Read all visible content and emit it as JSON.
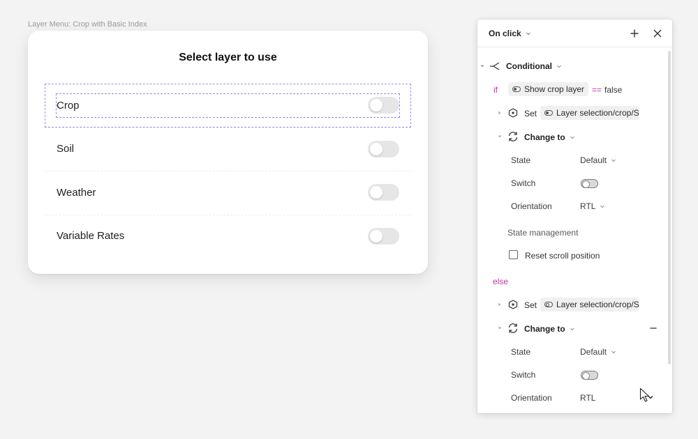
{
  "frame_label": "Layer Menu: Crop with Basic Index",
  "modal": {
    "title": "Select layer to use",
    "layers": [
      {
        "name": "Crop",
        "enabled": false,
        "selected": true
      },
      {
        "name": "Soil",
        "enabled": false,
        "selected": false
      },
      {
        "name": "Weather",
        "enabled": false,
        "selected": false
      },
      {
        "name": "Variable Rates",
        "enabled": false,
        "selected": false
      }
    ]
  },
  "panel": {
    "trigger": "On click",
    "conditional": {
      "label": "Conditional",
      "if_keyword": "if",
      "condition_variable": "Show crop layer",
      "operator": "==",
      "condition_value": "false",
      "else_keyword": "else"
    },
    "if_actions": {
      "set_label": "Set",
      "set_target": "Layer selection/crop/S",
      "change_to_label": "Change to",
      "properties": [
        {
          "label": "State",
          "value": "Default"
        },
        {
          "label": "Switch",
          "value": "off"
        },
        {
          "label": "Orientation",
          "value": "RTL"
        }
      ],
      "state_management_label": "State management",
      "reset_scroll_label": "Reset scroll position"
    },
    "else_actions": {
      "set_label": "Set",
      "set_target": "Layer selection/crop/S",
      "change_to_label": "Change to",
      "properties": [
        {
          "label": "State",
          "value": "Default"
        },
        {
          "label": "Switch",
          "value": "off"
        },
        {
          "label": "Orientation",
          "value": "RTL"
        }
      ]
    }
  },
  "icons": {
    "add": "plus-icon",
    "close": "close-icon",
    "conditional": "branch-icon",
    "set": "variable-hexagon-icon",
    "change_to": "swap-icon",
    "cursor": "pointer-cursor-icon"
  },
  "colors": {
    "keyword": "#c4319d",
    "selection_outline": "#a78bf0"
  }
}
